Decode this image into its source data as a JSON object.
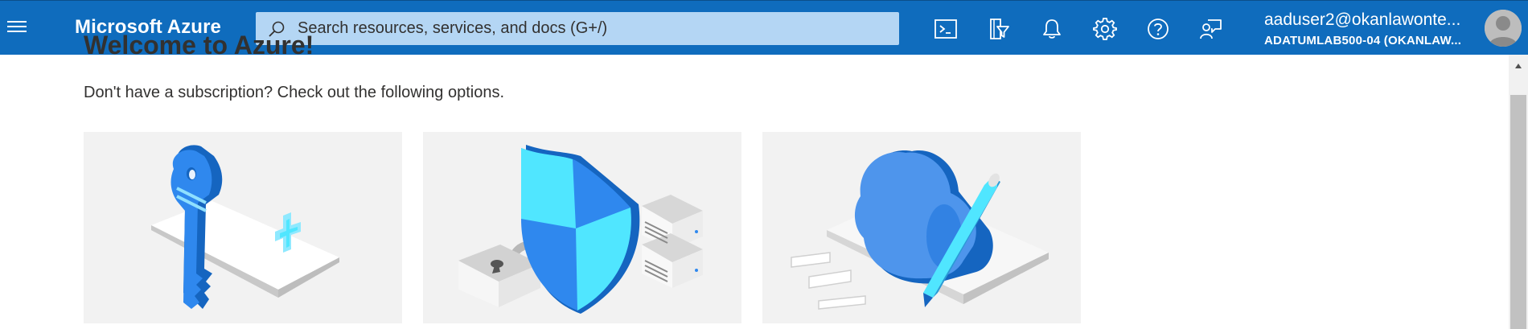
{
  "header": {
    "brand": "Microsoft Azure",
    "search_placeholder": "Search resources, services, and docs (G+/)",
    "icons": [
      "cloud-shell-icon",
      "directory-filter-icon",
      "notifications-icon",
      "settings-icon",
      "help-icon",
      "feedback-icon"
    ],
    "user_email": "aaduser2@okanlawonte...",
    "user_tenant": "ADATUMLAB500-04 (OKANLAW..."
  },
  "main": {
    "welcome_title": "Welcome to Azure!",
    "subtitle": "Don't have a subscription? Check out the following options.",
    "cards": [
      "key-illustration",
      "security-illustration",
      "cloud-illustration"
    ]
  },
  "colors": {
    "topbar": "#0f6cbd",
    "search_bg": "#b4d6f4",
    "card_bg": "#f2f2f2",
    "accent_blue": "#1a73d9",
    "accent_cyan": "#50e6ff"
  }
}
